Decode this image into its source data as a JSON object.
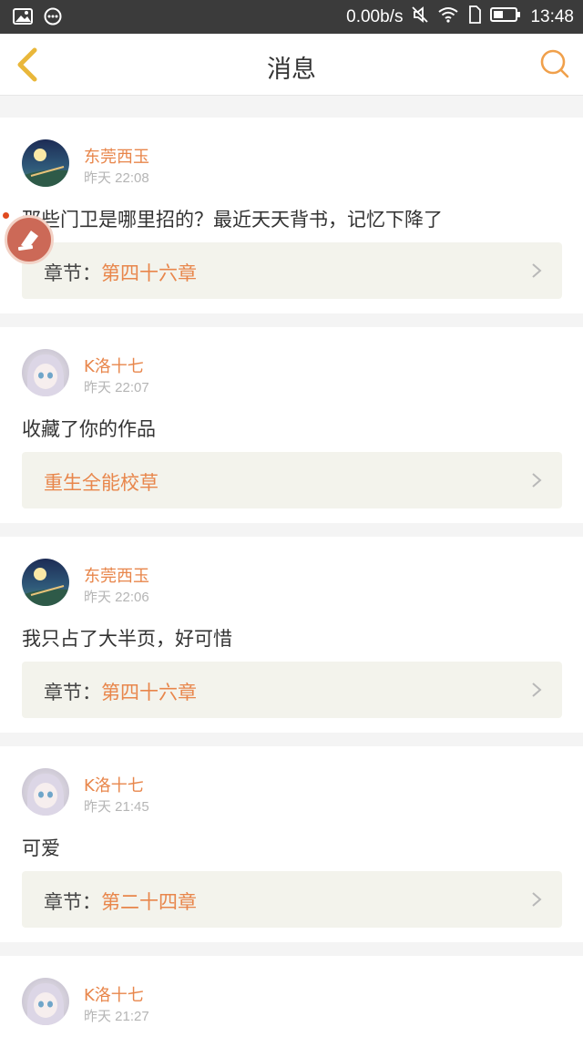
{
  "status_bar": {
    "speed": "0.00b/s",
    "time": "13:48"
  },
  "header": {
    "title": "消息"
  },
  "accent_color": "#e8864b",
  "messages": [
    {
      "user": "东莞西玉",
      "avatar": "moon-night",
      "time": "昨天 22:08",
      "text": "那些门卫是哪里招的？最近天天背书，记忆下降了",
      "ref_label": "章节：",
      "ref_value": "第四十六章"
    },
    {
      "user": "K洛十七",
      "avatar": "anime-girl",
      "time": "昨天 22:07",
      "text": "收藏了你的作品",
      "ref_label": "",
      "ref_value": "重生全能校草"
    },
    {
      "user": "东莞西玉",
      "avatar": "moon-night",
      "time": "昨天 22:06",
      "text": "我只占了大半页，好可惜",
      "ref_label": "章节：",
      "ref_value": "第四十六章"
    },
    {
      "user": "K洛十七",
      "avatar": "anime-girl",
      "time": "昨天 21:45",
      "text": "可爱",
      "ref_label": "章节：",
      "ref_value": "第二十四章"
    },
    {
      "user": "K洛十七",
      "avatar": "anime-girl",
      "time": "昨天 21:27"
    }
  ]
}
